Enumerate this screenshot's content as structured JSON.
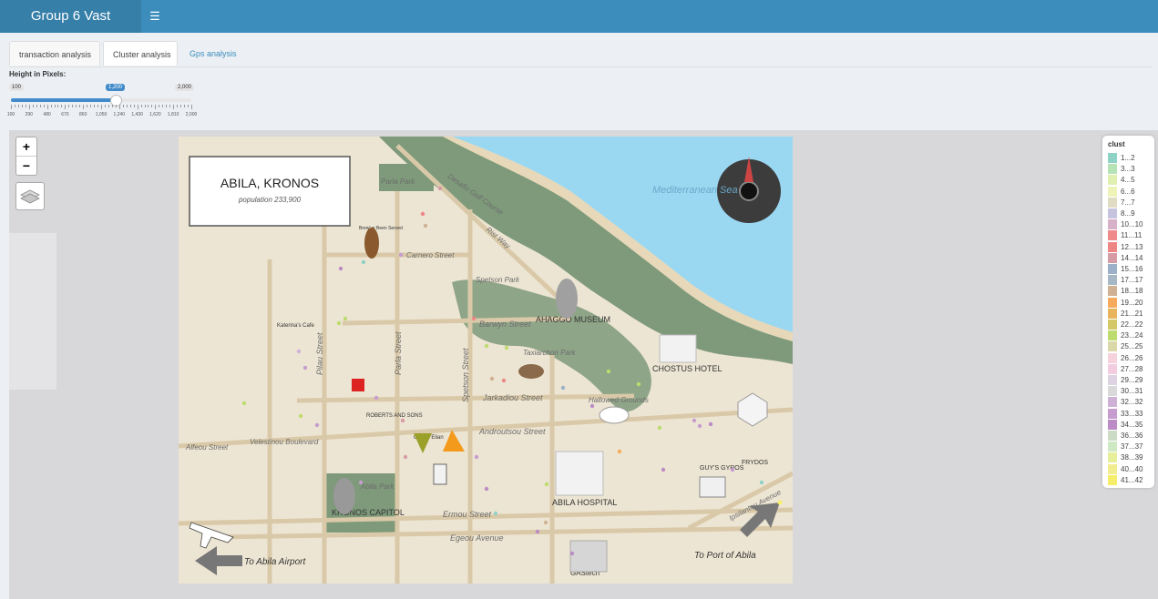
{
  "app": {
    "title": "Group 6 Vast",
    "menu_icon": "hamburger-icon"
  },
  "tabs": [
    {
      "label": "transaction analysis",
      "active": false
    },
    {
      "label": "Cluster analysis",
      "active": true
    },
    {
      "label": "Gps analysis",
      "active": false
    }
  ],
  "slider": {
    "label": "Height in Pixels:",
    "min": "100",
    "max": "2,000",
    "value": "1,200",
    "value_fraction": 0.579,
    "ticks": [
      "100",
      "290",
      "480",
      "670",
      "860",
      "1,050",
      "1,240",
      "1,430",
      "1,620",
      "1,810",
      "2,000"
    ]
  },
  "map": {
    "zoom_in": "+",
    "zoom_out": "−",
    "layers_icon": "layers-icon",
    "title": "ABILA, KRONOS",
    "subtitle": "population 233,900",
    "sea_label": "Mediterranean Sea",
    "labels": {
      "golf": "Desafio Golf Course",
      "parla_park": "Parla Park",
      "carnero": "Carnero Street",
      "rist_way": "Rist Way",
      "spetson_park": "Spetson Park",
      "barwyn": "Barwyn Street",
      "ahaggo": "AHAGGO MUSEUM",
      "taxiarchon": "Taxiarchon Park",
      "chostus": "CHOSTUS HOTEL",
      "jarkadiou": "Jarkadiou Street",
      "hallowed": "Hallowed Grounds",
      "androutsou": "Androutsou Street",
      "pilau": "Pilau Street",
      "parla_st": "Parla Street",
      "spetson_st": "Spetson Street",
      "alfeou": "Alfeou Street",
      "velestinou": "Velestinou Boulevard",
      "abila_park": "Abila Park",
      "kronos_capitol": "KRONOS CAPITOL",
      "ermou": "Ermou Street",
      "egeou": "Egeou Avenue",
      "abila_hospital": "ABILA HOSPITAL",
      "ipsilantou": "Ipsilantou Avenue",
      "to_airport": "To Abila Airport",
      "to_port": "To Port of Abila",
      "guys_gyros": "GUY'S GYROS",
      "frydos": "FRYDOS",
      "roberts": "ROBERTS AND SONS",
      "katerinas": "Katerina's Cafe",
      "gastech": "GAStech",
      "ouzeri": "Ouzeri Elian",
      "brew": "Brew've Been Served"
    }
  },
  "legend": {
    "title": "clust",
    "items": [
      {
        "label": "1...2",
        "color": "#8fd3c6"
      },
      {
        "label": "3...3",
        "color": "#b6e3b6"
      },
      {
        "label": "4...5",
        "color": "#dff0b0"
      },
      {
        "label": "6...6",
        "color": "#eef4b8"
      },
      {
        "label": "7...7",
        "color": "#e0dcc4"
      },
      {
        "label": "8...9",
        "color": "#c6c3de"
      },
      {
        "label": "10...10",
        "color": "#d7b1c8"
      },
      {
        "label": "11...11",
        "color": "#ee8a8a"
      },
      {
        "label": "12...13",
        "color": "#ef8686"
      },
      {
        "label": "14...14",
        "color": "#d69ca6"
      },
      {
        "label": "15...16",
        "color": "#9db0ca"
      },
      {
        "label": "17...17",
        "color": "#a6b8c5"
      },
      {
        "label": "18...18",
        "color": "#d0b194"
      },
      {
        "label": "19...20",
        "color": "#f6ab5c"
      },
      {
        "label": "21...21",
        "color": "#e8b45c"
      },
      {
        "label": "22...22",
        "color": "#d4c767"
      },
      {
        "label": "23...24",
        "color": "#bddb6f"
      },
      {
        "label": "25...25",
        "color": "#dad7a9"
      },
      {
        "label": "26...26",
        "color": "#f5d2dc"
      },
      {
        "label": "27...28",
        "color": "#f2cde0"
      },
      {
        "label": "29...29",
        "color": "#ddd3e2"
      },
      {
        "label": "30...31",
        "color": "#d9d9d9"
      },
      {
        "label": "32...32",
        "color": "#ceb2d6"
      },
      {
        "label": "33...33",
        "color": "#c79cce"
      },
      {
        "label": "34...35",
        "color": "#bb8cc5"
      },
      {
        "label": "36...36",
        "color": "#cbdbc6"
      },
      {
        "label": "37...37",
        "color": "#cfe8c4"
      },
      {
        "label": "38...39",
        "color": "#e8ef9a"
      },
      {
        "label": "40...40",
        "color": "#f2ee90"
      },
      {
        "label": "41...42",
        "color": "#f6ee6a"
      }
    ]
  }
}
